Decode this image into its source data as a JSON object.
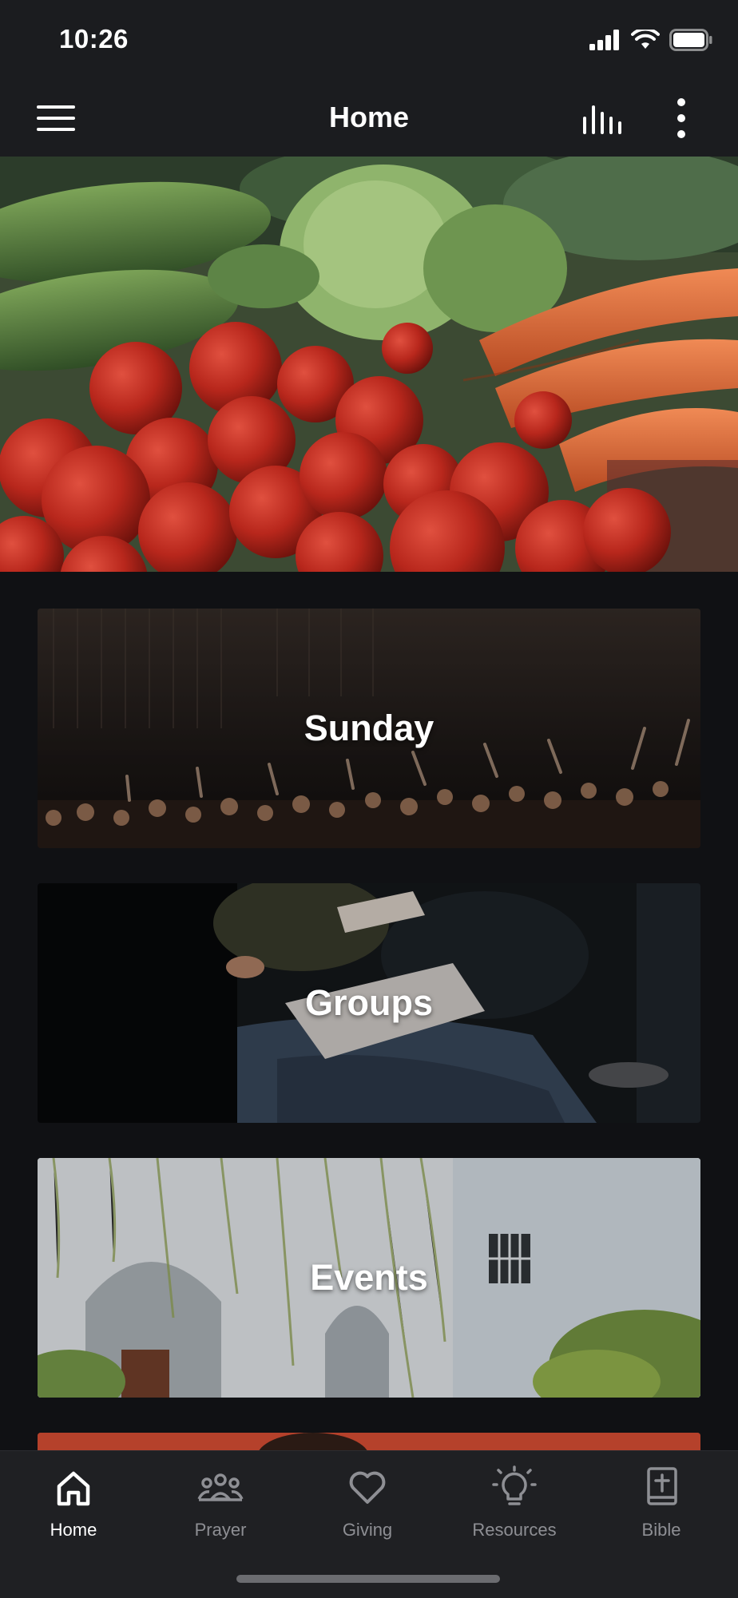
{
  "status": {
    "time": "10:26"
  },
  "header": {
    "title": "Home"
  },
  "icons": {
    "menu": "hamburger-menu-icon",
    "stats": "bar-chart-icon",
    "more": "vertical-ellipsis-icon"
  },
  "cards": [
    {
      "title": "Sunday",
      "image": "worship crowd with raised hands"
    },
    {
      "title": "Groups",
      "image": "people reading books in a group"
    },
    {
      "title": "Events",
      "image": "white building with arches and vines"
    }
  ],
  "tabs": [
    {
      "label": "Home",
      "icon": "home-icon",
      "active": true
    },
    {
      "label": "Prayer",
      "icon": "group-icon",
      "active": false
    },
    {
      "label": "Giving",
      "icon": "heart-icon",
      "active": false
    },
    {
      "label": "Resources",
      "icon": "lightbulb-icon",
      "active": false
    },
    {
      "label": "Bible",
      "icon": "bible-icon",
      "active": false
    }
  ],
  "colors": {
    "background": "#101114",
    "bar": "#1b1c1f",
    "tab_active": "#ffffff",
    "tab_inactive": "#8e8f94"
  }
}
